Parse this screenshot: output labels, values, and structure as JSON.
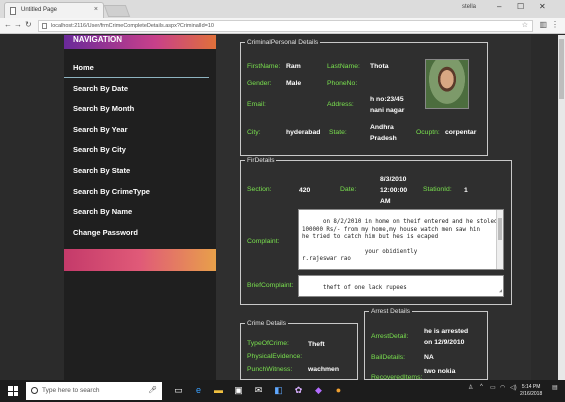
{
  "browser": {
    "tab_title": "Untitled Page",
    "tab_close": "×",
    "user_name": "stella",
    "url": "localhost:2116/User/frmCrimeCompleteDetails.aspx?CriminalId=10"
  },
  "sidebar": {
    "heading": "NAVIGATION",
    "items": [
      {
        "label": "Home"
      },
      {
        "label": "Search By Date"
      },
      {
        "label": "Search By Month"
      },
      {
        "label": "Search By Year"
      },
      {
        "label": "Search By City"
      },
      {
        "label": "Search By State"
      },
      {
        "label": "Search By CrimeType"
      },
      {
        "label": "Search By Name"
      },
      {
        "label": "Change Password"
      }
    ]
  },
  "personal": {
    "legend": "CriminalPersonal Details",
    "firstname_label": "FirstName:",
    "firstname": "Ram",
    "lastname_label": "LastName:",
    "lastname": "Thota",
    "gender_label": "Gender:",
    "gender": "Male",
    "phone_label": "PhoneNo:",
    "phone": "",
    "email_label": "Email:",
    "email": "",
    "address_label": "Address:",
    "address_l1": "h no:23/45",
    "address_l2": "nani nagar",
    "city_label": "City:",
    "city": "hyderabad",
    "state_label": "State:",
    "state_l1": "Andhra",
    "state_l2": "Pradesh",
    "occupation_label": "Ocuptn:",
    "occupation": "corpentar"
  },
  "fir": {
    "legend": "FirDetails",
    "section_label": "Section:",
    "section": "420",
    "date_label": "Date:",
    "date_l1": "8/3/2010",
    "date_l2": "12:00:00",
    "date_l3": "AM",
    "station_label": "StationId:",
    "station": "1",
    "complaint_label": "Complaint:",
    "complaint": "on 8/2/2010 in home on theif entered and he stoled\n100000 Rs/- from my home,my house watch men saw hin\nhe tried to catch him but hes is ecaped\n\n                  your obidiently\nr.rajeswar rao",
    "brief_label": "BriefComplaint:",
    "brief": "theft of one lack rupees"
  },
  "crime": {
    "legend": "Crime Details",
    "type_label": "TypeOfCrime:",
    "type": "Theft",
    "evidence_label": "PhysicalEvidence:",
    "evidence": "",
    "witness_label": "PunchWitness:",
    "witness": "wachmen"
  },
  "arrest": {
    "legend": "Arrest Details",
    "detail_label": "ArrestDetail:",
    "detail_l1": "he is arrested",
    "detail_l2": "on 12/9/2010",
    "bail_label": "BailDetails:",
    "bail": "NA",
    "recovered_label": "RecoveredItems:",
    "recovered": "two nokia"
  },
  "taskbar": {
    "search_placeholder": "Type here to search",
    "time": "5:14 PM",
    "date": "2/16/2018"
  }
}
